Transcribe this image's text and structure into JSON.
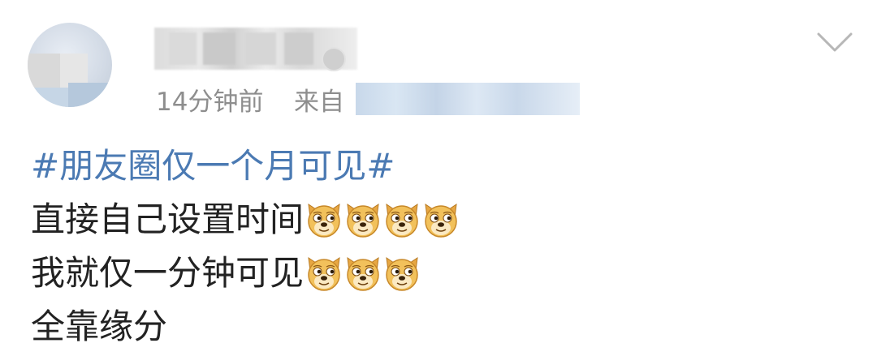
{
  "post": {
    "timestamp": "14分钟前",
    "source_label": "来自",
    "more_icon": "chevron-down-icon",
    "topic": "#朋友圈仅一个月可见#",
    "lines": [
      {
        "text": "直接自己设置时间",
        "emoji_count": 4,
        "emoji": "doge-emoji-icon"
      },
      {
        "text": "我就仅一分钟可见",
        "emoji_count": 3,
        "emoji": "doge-emoji-icon"
      },
      {
        "text": "全靠缘分",
        "emoji_count": 0
      }
    ]
  },
  "colors": {
    "topic_link": "#4b7ab3",
    "body_text": "#222222",
    "meta_text": "#8e8e8e"
  }
}
